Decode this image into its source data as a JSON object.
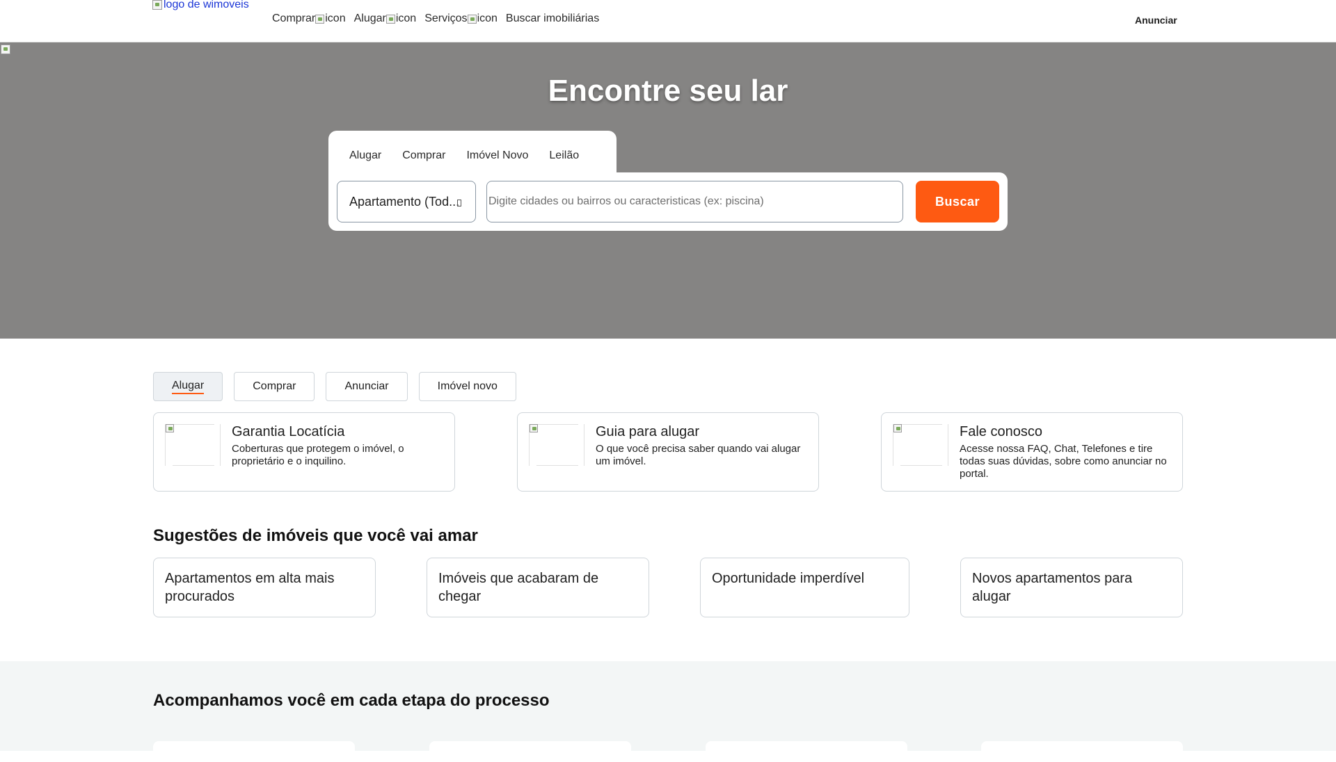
{
  "header": {
    "logo_alt": "logo de wimoveis",
    "nav": [
      {
        "label": "Comprar",
        "icon_alt": "icon"
      },
      {
        "label": "Alugar",
        "icon_alt": "icon"
      },
      {
        "label": "Serviços",
        "icon_alt": "icon"
      },
      {
        "label": "Buscar imobiliárias"
      }
    ],
    "anunciar": "Anunciar"
  },
  "hero": {
    "title": "Encontre seu lar",
    "tabs": [
      "Alugar",
      "Comprar",
      "Imóvel Novo",
      "Leilão"
    ],
    "property_type": "Apartamento (Tod...",
    "search_placeholder": "Digite cidades ou bairros ou caracteristicas (ex: piscina)",
    "search_button": "Buscar"
  },
  "chips": {
    "items": [
      "Alugar",
      "Comprar",
      "Anunciar",
      "Imóvel novo"
    ],
    "active": "Alugar"
  },
  "services": [
    {
      "title": "Garantia Locatícia",
      "description": "Coberturas que protegem o imóvel, o proprietário e o inquilino."
    },
    {
      "title": "Guia para alugar",
      "description": "O que você precisa saber quando vai alugar um imóvel."
    },
    {
      "title": "Fale conosco",
      "description": "Acesse nossa FAQ, Chat, Telefones e tire todas suas dúvidas, sobre como anunciar no portal."
    }
  ],
  "suggestions": {
    "heading": "Sugestões de imóveis que você vai amar",
    "items": [
      "Apartamentos em alta mais procurados",
      "Imóveis que acabaram de chegar",
      "Oportunidade imperdível",
      "Novos apartamentos para alugar"
    ]
  },
  "process": {
    "heading": "Acompanhamos você em cada etapa do processo"
  },
  "colors": {
    "accent": "#fe5a12",
    "hero_bg": "#858483",
    "process_bg": "#f3f6f6"
  }
}
